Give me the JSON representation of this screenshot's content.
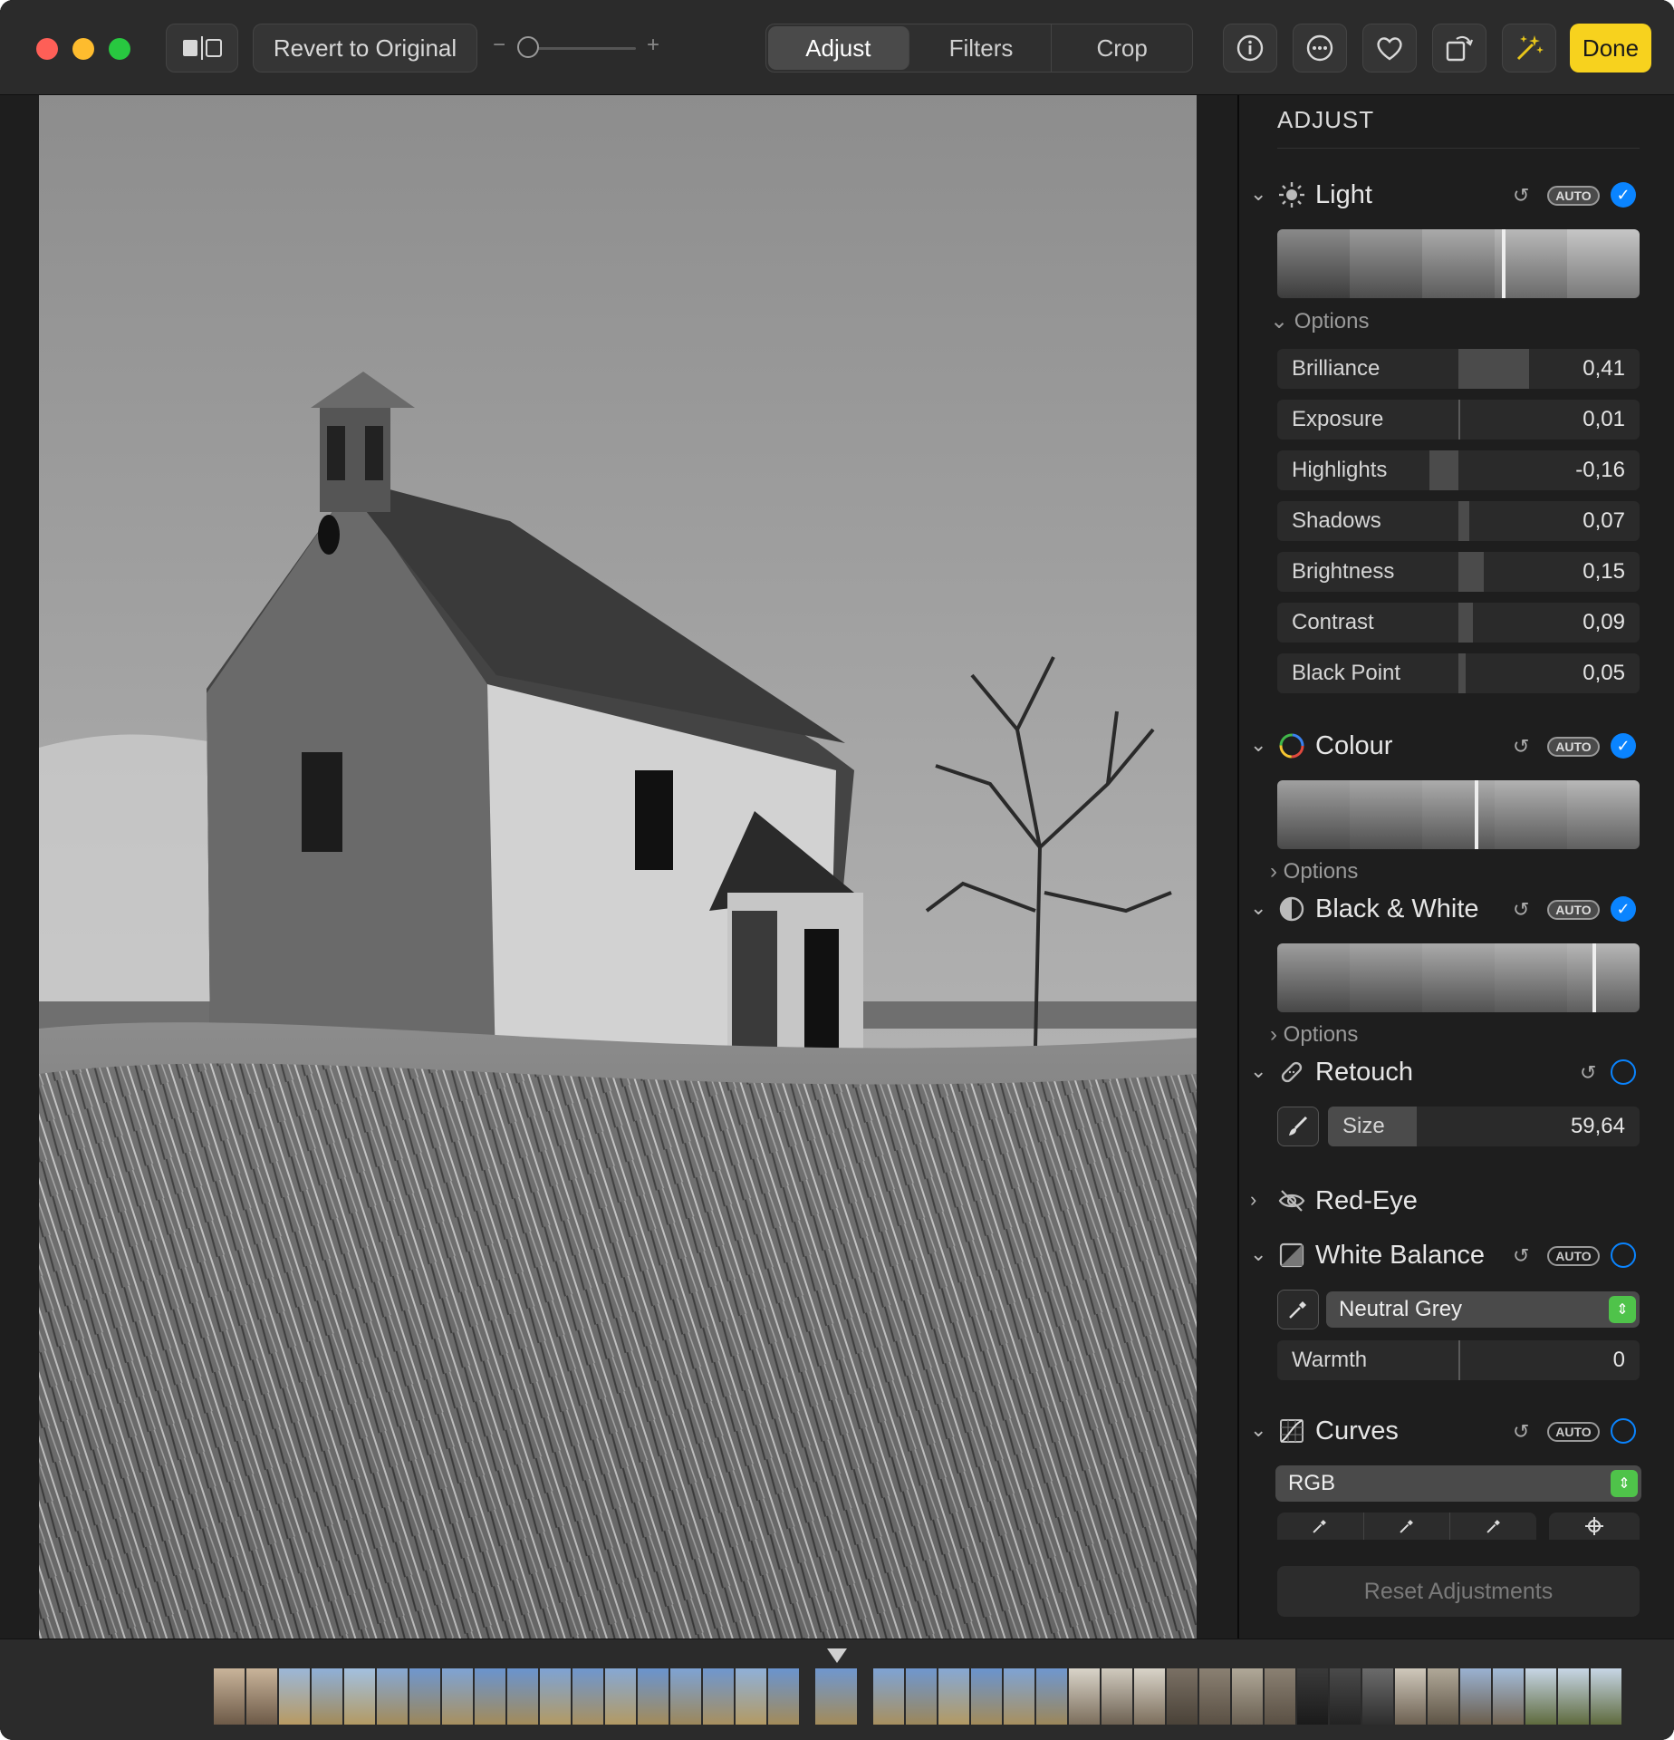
{
  "toolbar": {
    "revert_label": "Revert to Original",
    "zoom_minus": "−",
    "zoom_plus": "+",
    "tabs": [
      "Adjust",
      "Filters",
      "Crop"
    ],
    "done_label": "Done"
  },
  "sidebar": {
    "title": "ADJUST",
    "light": {
      "label": "Light",
      "auto": "AUTO",
      "options_label": "Options",
      "sliders": [
        {
          "label": "Brilliance",
          "value": "0,41"
        },
        {
          "label": "Exposure",
          "value": "0,01"
        },
        {
          "label": "Highlights",
          "value": "-0,16"
        },
        {
          "label": "Shadows",
          "value": "0,07"
        },
        {
          "label": "Brightness",
          "value": "0,15"
        },
        {
          "label": "Contrast",
          "value": "0,09"
        },
        {
          "label": "Black Point",
          "value": "0,05"
        }
      ]
    },
    "colour": {
      "label": "Colour",
      "auto": "AUTO",
      "options_label": "Options"
    },
    "bw": {
      "label": "Black & White",
      "auto": "AUTO",
      "options_label": "Options"
    },
    "retouch": {
      "label": "Retouch",
      "size_label": "Size",
      "size_value": "59,64"
    },
    "redeye": {
      "label": "Red-Eye"
    },
    "wb": {
      "label": "White Balance",
      "auto": "AUTO",
      "mode": "Neutral Grey",
      "warmth_label": "Warmth",
      "warmth_value": "0"
    },
    "curves": {
      "label": "Curves",
      "auto": "AUTO",
      "channel": "RGB"
    },
    "reset_label": "Reset Adjustments"
  },
  "colors": {
    "accent": "#0a84ff",
    "done": "#f7d21e",
    "select_arrow": "#4fc34a"
  }
}
